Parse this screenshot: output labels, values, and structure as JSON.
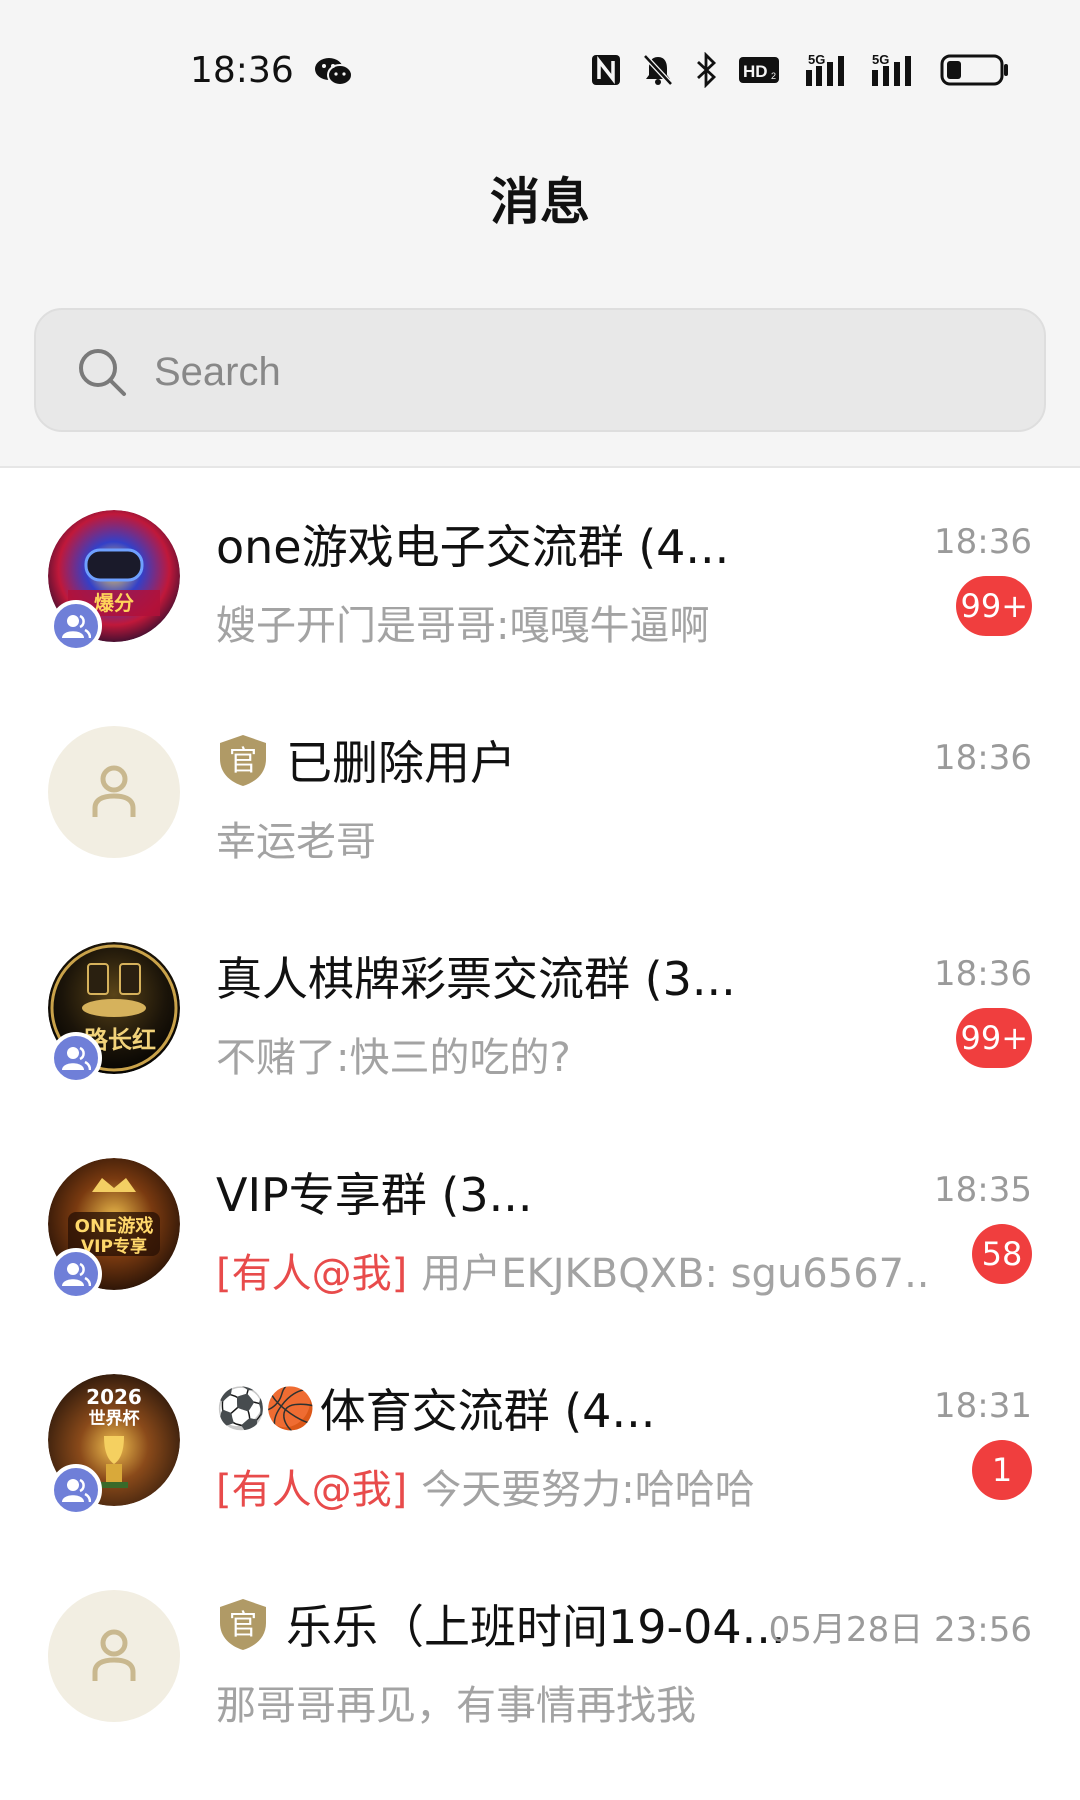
{
  "status_bar": {
    "time": "18:36",
    "icons": [
      "wechat-icon",
      "nfc-icon",
      "bell-off-icon",
      "bluetooth-icon",
      "hd-voice-icon",
      "signal-5g-icon",
      "signal-5g-icon",
      "battery-icon"
    ]
  },
  "header": {
    "title": "消息"
  },
  "search": {
    "placeholder": "Search"
  },
  "colors": {
    "unread_badge": "#f03e3e",
    "mention": "#e84b4b",
    "group_badge": "#6f7fd8",
    "official_tag": "#b09a66"
  },
  "conversations": [
    {
      "title": "one游戏电子交流群 (4...",
      "time": "18:36",
      "preview": "嫂子开门是哥哥:嘎嘎牛逼啊",
      "unread": "99+",
      "type": "group"
    },
    {
      "tag": "官",
      "title": "已删除用户",
      "time": "18:36",
      "preview": "幸运老哥",
      "type": "official"
    },
    {
      "title": "真人棋牌彩票交流群 (3...",
      "time": "18:36",
      "preview": "不赌了:快三的吃的?",
      "unread": "99+",
      "type": "group"
    },
    {
      "title": "VIP专享群 (3...",
      "time": "18:35",
      "mention": "[有人@我]",
      "preview": "用户EKJKBQXB: sgu6567..",
      "unread": "58",
      "type": "group"
    },
    {
      "emoji": "⚽🏀",
      "title": "体育交流群 (4...",
      "time": "18:31",
      "mention": "[有人@我]",
      "preview": "今天要努力:哈哈哈",
      "unread": "1",
      "type": "group"
    },
    {
      "tag": "官",
      "title": "乐乐（上班时间19-04...",
      "time": "05月28日 23:56",
      "preview": "那哥哥再见，有事情再找我",
      "type": "official"
    }
  ]
}
